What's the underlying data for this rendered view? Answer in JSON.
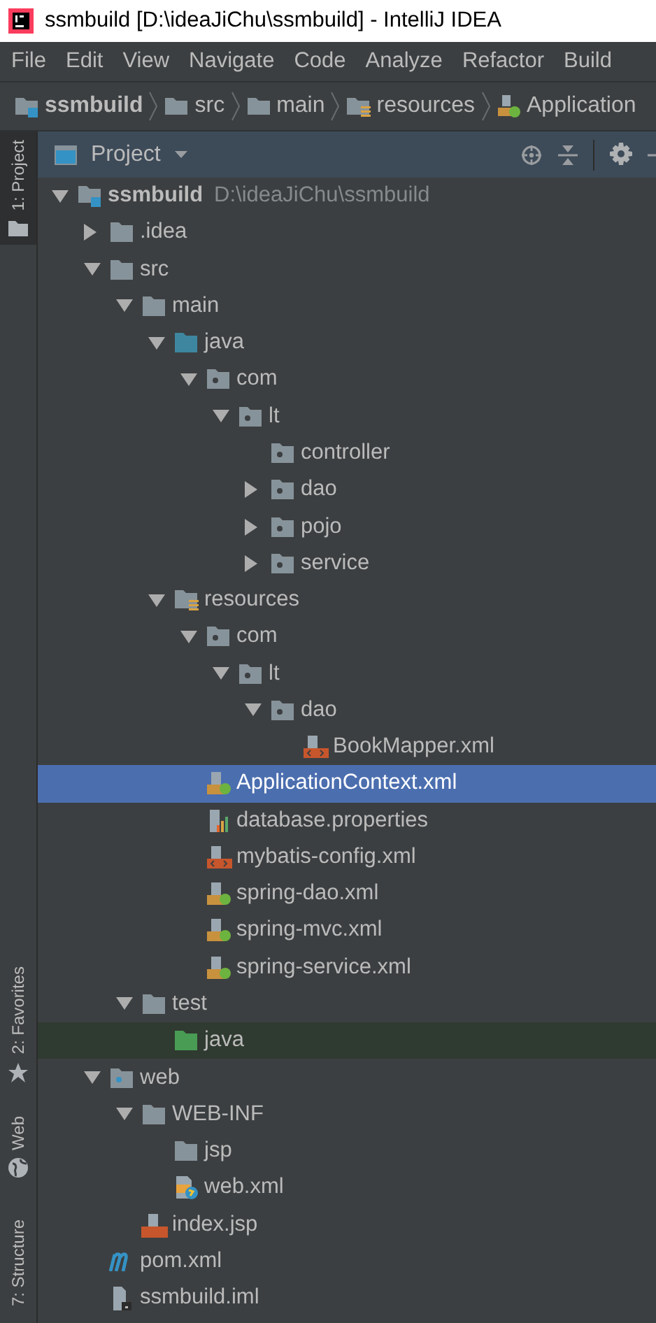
{
  "window": {
    "title": "ssmbuild [D:\\ideaJiChu\\ssmbuild] - IntelliJ IDEA"
  },
  "menu": [
    "File",
    "Edit",
    "View",
    "Navigate",
    "Code",
    "Analyze",
    "Refactor",
    "Build"
  ],
  "breadcrumbs": [
    {
      "label": "ssmbuild",
      "kind": "module"
    },
    {
      "label": "src",
      "kind": "folder"
    },
    {
      "label": "main",
      "kind": "folder"
    },
    {
      "label": "resources",
      "kind": "resources"
    },
    {
      "label": "Application",
      "kind": "xml-spring"
    }
  ],
  "tool_strip": [
    {
      "label": "1: Project",
      "kind": "folder",
      "selected": true
    },
    {
      "label": "2: Favorites",
      "kind": "star",
      "selected": false
    },
    {
      "label": "Web",
      "kind": "globe",
      "selected": false
    },
    {
      "label": "7: Structure",
      "kind": "none",
      "selected": false
    }
  ],
  "panel": {
    "title": "Project"
  },
  "tree": [
    {
      "name": "ssmbuild",
      "hint": "D:\\ideaJiChu\\ssmbuild",
      "kind": "module",
      "expanded": true,
      "selected": false,
      "highlighted": false,
      "children": [
        {
          "name": ".idea",
          "kind": "folder",
          "expanded": false,
          "selected": false,
          "highlighted": false
        },
        {
          "name": "src",
          "kind": "folder",
          "expanded": true,
          "selected": false,
          "highlighted": false,
          "children": [
            {
              "name": "main",
              "kind": "folder",
              "expanded": true,
              "selected": false,
              "highlighted": false,
              "children": [
                {
                  "name": "java",
                  "kind": "source",
                  "expanded": true,
                  "selected": false,
                  "highlighted": false,
                  "children": [
                    {
                      "name": "com",
                      "kind": "package",
                      "expanded": true,
                      "selected": false,
                      "highlighted": false,
                      "children": [
                        {
                          "name": "lt",
                          "kind": "package",
                          "expanded": true,
                          "selected": false,
                          "highlighted": false,
                          "children": [
                            {
                              "name": "controller",
                              "kind": "package",
                              "selected": false,
                              "highlighted": false
                            },
                            {
                              "name": "dao",
                              "kind": "package",
                              "expanded": false,
                              "selected": false,
                              "highlighted": false
                            },
                            {
                              "name": "pojo",
                              "kind": "package",
                              "expanded": false,
                              "selected": false,
                              "highlighted": false
                            },
                            {
                              "name": "service",
                              "kind": "package",
                              "expanded": false,
                              "selected": false,
                              "highlighted": false
                            }
                          ]
                        }
                      ]
                    }
                  ]
                },
                {
                  "name": "resources",
                  "kind": "resources",
                  "expanded": true,
                  "selected": false,
                  "highlighted": false,
                  "children": [
                    {
                      "name": "com",
                      "kind": "package",
                      "expanded": true,
                      "selected": false,
                      "highlighted": false,
                      "children": [
                        {
                          "name": "lt",
                          "kind": "package",
                          "expanded": true,
                          "selected": false,
                          "highlighted": false,
                          "children": [
                            {
                              "name": "dao",
                              "kind": "package",
                              "expanded": true,
                              "selected": false,
                              "highlighted": false,
                              "children": [
                                {
                                  "name": "BookMapper.xml",
                                  "kind": "xml-mybatis",
                                  "selected": false,
                                  "highlighted": false
                                }
                              ]
                            }
                          ]
                        }
                      ]
                    },
                    {
                      "name": "ApplicationContext.xml",
                      "kind": "xml-spring",
                      "selected": true,
                      "highlighted": false
                    },
                    {
                      "name": "database.properties",
                      "kind": "properties",
                      "selected": false,
                      "highlighted": false
                    },
                    {
                      "name": "mybatis-config.xml",
                      "kind": "xml-mybatis",
                      "selected": false,
                      "highlighted": false
                    },
                    {
                      "name": "spring-dao.xml",
                      "kind": "xml-spring",
                      "selected": false,
                      "highlighted": false
                    },
                    {
                      "name": "spring-mvc.xml",
                      "kind": "xml-spring",
                      "selected": false,
                      "highlighted": false
                    },
                    {
                      "name": "spring-service.xml",
                      "kind": "xml-spring",
                      "selected": false,
                      "highlighted": false
                    }
                  ]
                }
              ]
            },
            {
              "name": "test",
              "kind": "folder",
              "expanded": true,
              "selected": false,
              "highlighted": false,
              "children": [
                {
                  "name": "java",
                  "kind": "test",
                  "selected": false,
                  "highlighted": true
                }
              ]
            }
          ]
        },
        {
          "name": "web",
          "kind": "web",
          "expanded": true,
          "selected": false,
          "highlighted": false,
          "children": [
            {
              "name": "WEB-INF",
              "kind": "folder",
              "expanded": true,
              "selected": false,
              "highlighted": false,
              "children": [
                {
                  "name": "jsp",
                  "kind": "folder",
                  "selected": false,
                  "highlighted": false
                },
                {
                  "name": "web.xml",
                  "kind": "web-xml",
                  "selected": false,
                  "highlighted": false
                }
              ]
            },
            {
              "name": "index.jsp",
              "kind": "jsp",
              "selected": false,
              "highlighted": false
            }
          ]
        },
        {
          "name": "pom.xml",
          "kind": "maven",
          "selected": false,
          "highlighted": false
        },
        {
          "name": "ssmbuild.iml",
          "kind": "iml",
          "selected": false,
          "highlighted": false
        }
      ]
    }
  ]
}
